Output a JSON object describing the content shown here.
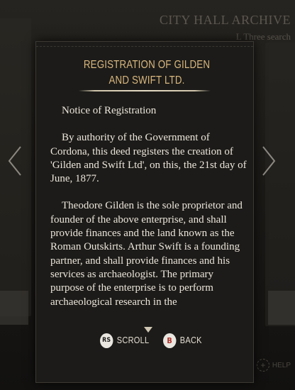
{
  "background": {
    "title": "CITY HALL ARCHIVE",
    "search_hint": "L Three search",
    "help_label": "HELP"
  },
  "document": {
    "title": "REGISTRATION OF GILDEN AND SWIFT LTD.",
    "paragraphs": [
      "Notice of Registration",
      "By authority of the Government of Cordona, this deed registers the creation of 'Gilden and Swift Ltd', on this, the 21st day of June, 1877.",
      "Theodore Gilden is the sole proprietor and founder of the above enterprise, and shall provide finances and the land known as the Roman Outskirts. Arthur Swift is a founding partner, and shall provide finances and his services as archaeologist. The primary purpose of the enterprise is to perform archaeological research in the"
    ]
  },
  "controls": {
    "scroll": {
      "button": "RS",
      "label": "SCROLL"
    },
    "back": {
      "button": "B",
      "label": "BACK"
    }
  },
  "colors": {
    "title": "#d9b77e",
    "panel": "#1c1b19",
    "text": "#ece6da",
    "back_button_glyph": "#b0332c"
  }
}
